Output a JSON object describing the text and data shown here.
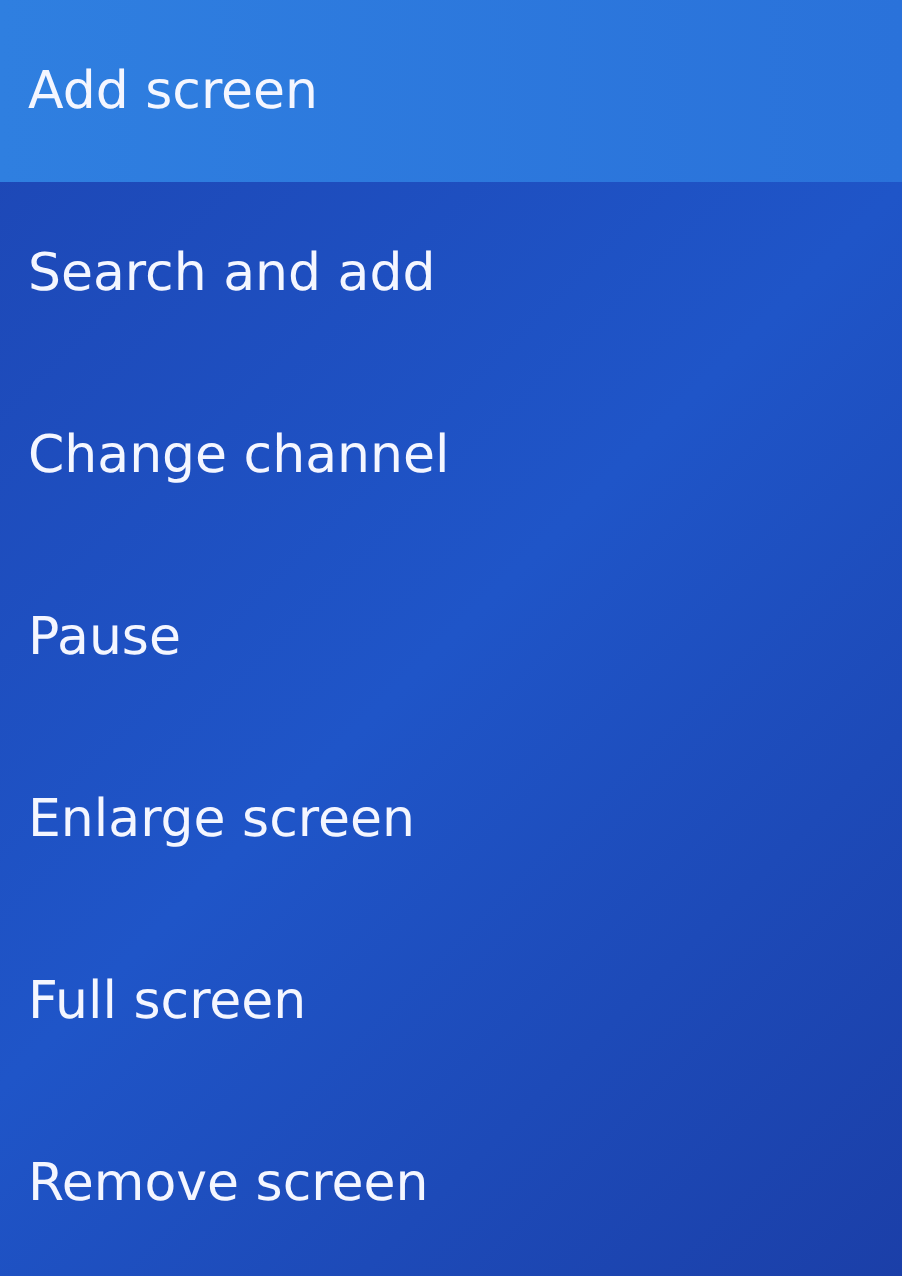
{
  "menu": {
    "items": [
      {
        "label": "Add screen",
        "selected": true
      },
      {
        "label": "Search and add",
        "selected": false
      },
      {
        "label": "Change channel",
        "selected": false
      },
      {
        "label": "Pause",
        "selected": false
      },
      {
        "label": "Enlarge screen",
        "selected": false
      },
      {
        "label": "Full screen",
        "selected": false
      },
      {
        "label": "Remove screen",
        "selected": false
      }
    ]
  }
}
